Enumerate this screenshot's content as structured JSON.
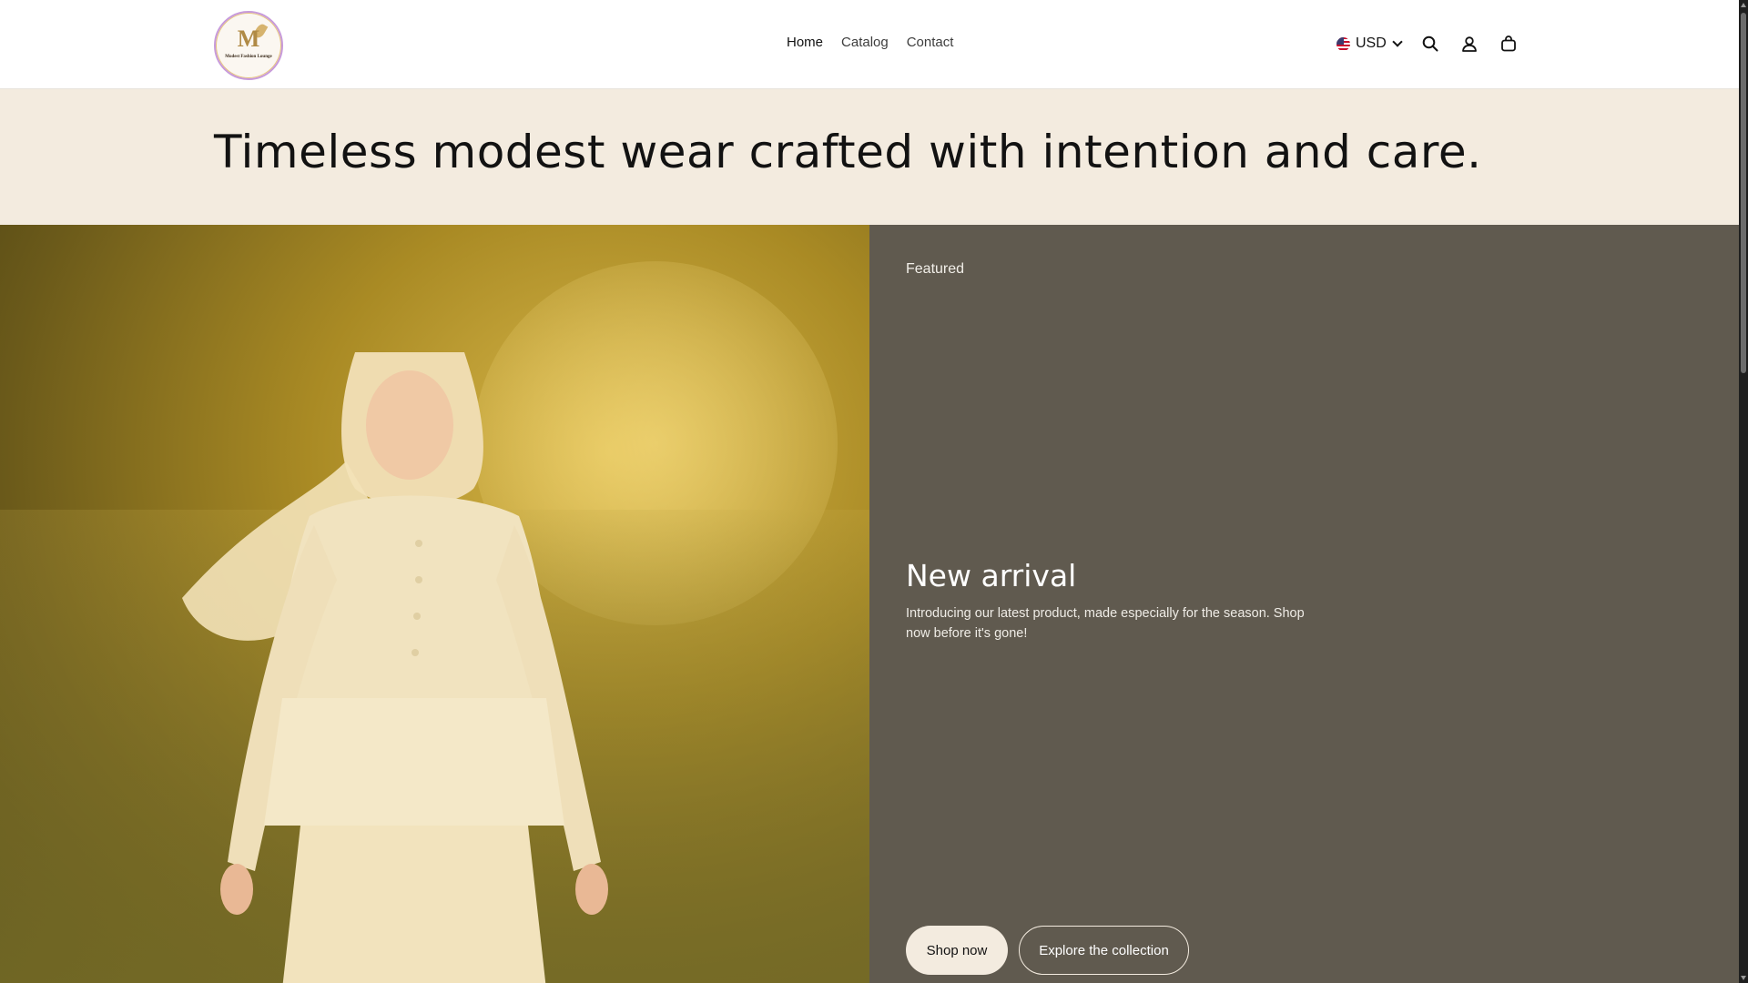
{
  "header": {
    "logo_text": "Modest Fashion Lounge",
    "logo_monogram": "M",
    "nav": [
      {
        "label": "Home",
        "active": true
      },
      {
        "label": "Catalog",
        "active": false
      },
      {
        "label": "Contact",
        "active": false
      }
    ],
    "currency": "USD",
    "icons": [
      "us-flag-icon",
      "chevron-down-icon",
      "search-icon",
      "account-icon",
      "cart-icon"
    ]
  },
  "banner": {
    "title": "Timeless modest wear crafted with intention and care."
  },
  "feature": {
    "label": "Featured",
    "title": "New arrival",
    "text": "Introducing our latest product, made especially for the season. Shop now before it's gone!",
    "primary_button": "Shop now",
    "secondary_button": "Explore the collection"
  },
  "colors": {
    "banner_bg": "#f3ebdf",
    "panel_bg": "#605a4f",
    "text_dark": "#121212"
  }
}
